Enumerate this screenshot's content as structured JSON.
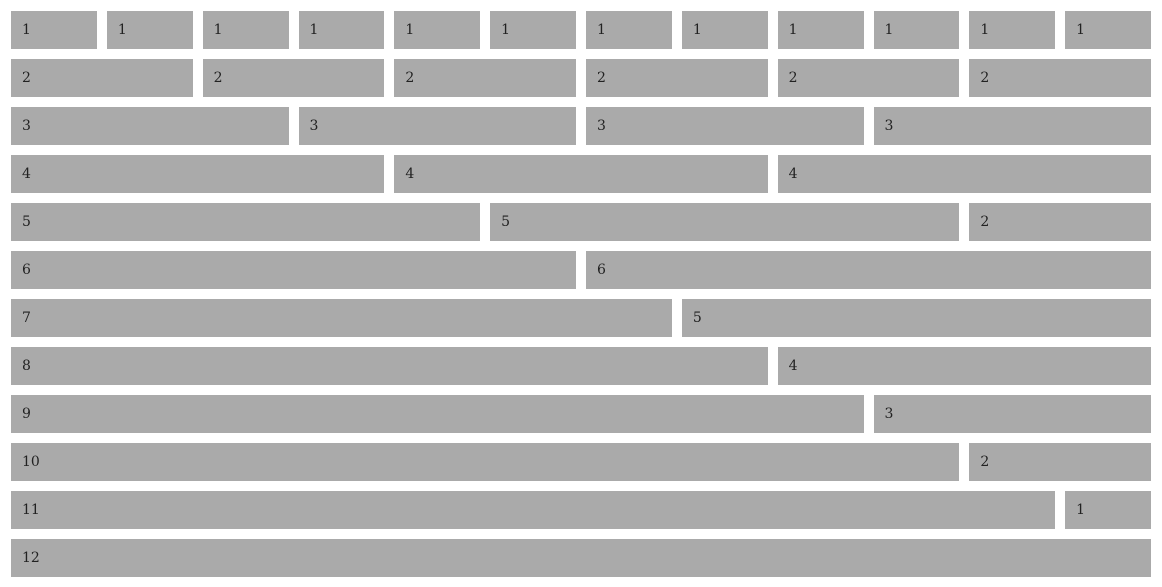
{
  "colors": {
    "background": "#ffffff",
    "cell_fill": "#aaaaaa",
    "cell_text": "#222222"
  },
  "rows": [
    {
      "cells": [
        "1",
        "1",
        "1",
        "1",
        "1",
        "1",
        "1",
        "1",
        "1",
        "1",
        "1",
        "1"
      ]
    },
    {
      "cells": [
        "2",
        "2",
        "2",
        "2",
        "2",
        "2"
      ]
    },
    {
      "cells": [
        "3",
        "3",
        "3",
        "3"
      ]
    },
    {
      "cells": [
        "4",
        "4",
        "4"
      ]
    },
    {
      "cells": [
        "5",
        "5",
        "2"
      ]
    },
    {
      "cells": [
        "6",
        "6"
      ]
    },
    {
      "cells": [
        "7",
        "5"
      ]
    },
    {
      "cells": [
        "8",
        "4"
      ]
    },
    {
      "cells": [
        "9",
        "3"
      ]
    },
    {
      "cells": [
        "10",
        "2"
      ]
    },
    {
      "cells": [
        "11",
        "1"
      ]
    },
    {
      "cells": [
        "12"
      ]
    }
  ]
}
